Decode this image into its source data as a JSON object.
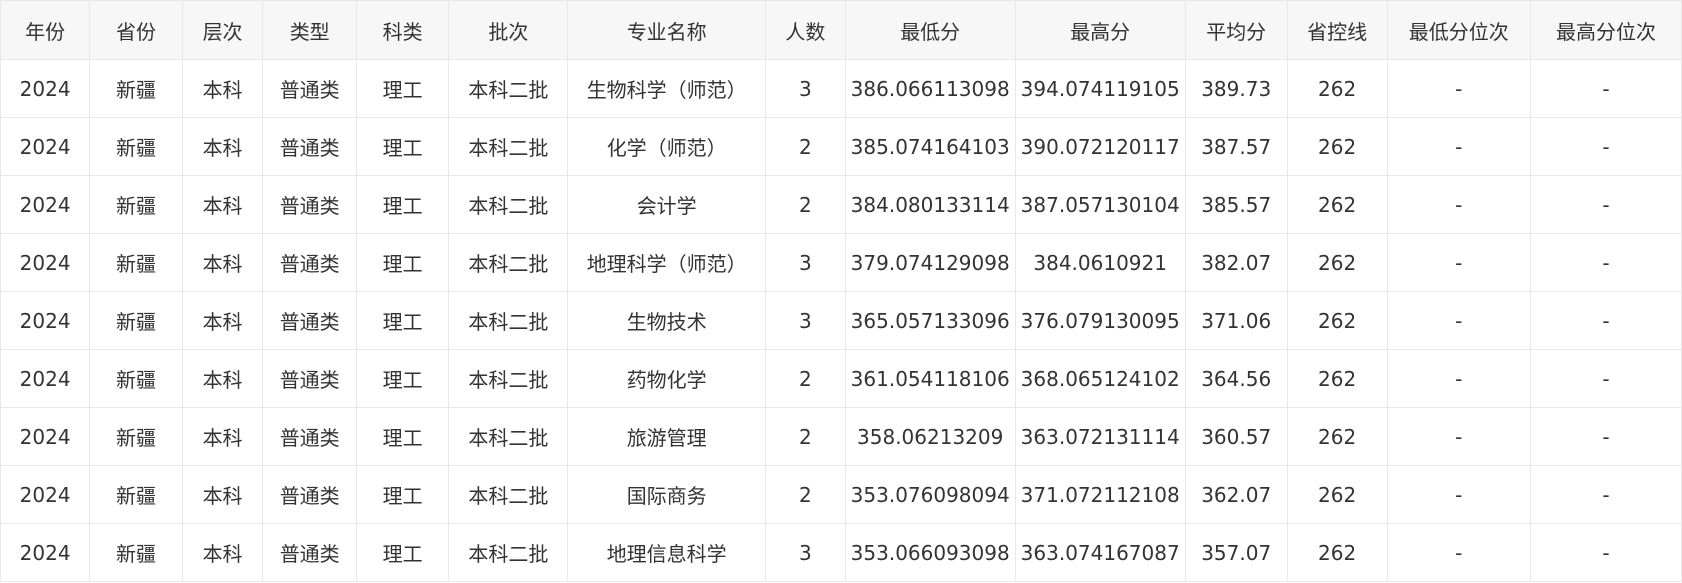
{
  "table": {
    "headers": [
      "年份",
      "省份",
      "层次",
      "类型",
      "科类",
      "批次",
      "专业名称",
      "人数",
      "最低分",
      "最高分",
      "平均分",
      "省控线",
      "最低分位次",
      "最高分位次"
    ],
    "rows": [
      [
        "2024",
        "新疆",
        "本科",
        "普通类",
        "理工",
        "本科二批",
        "生物科学（师范）",
        "3",
        "386.066113098",
        "394.074119105",
        "389.73",
        "262",
        "-",
        "-"
      ],
      [
        "2024",
        "新疆",
        "本科",
        "普通类",
        "理工",
        "本科二批",
        "化学（师范）",
        "2",
        "385.074164103",
        "390.072120117",
        "387.57",
        "262",
        "-",
        "-"
      ],
      [
        "2024",
        "新疆",
        "本科",
        "普通类",
        "理工",
        "本科二批",
        "会计学",
        "2",
        "384.080133114",
        "387.057130104",
        "385.57",
        "262",
        "-",
        "-"
      ],
      [
        "2024",
        "新疆",
        "本科",
        "普通类",
        "理工",
        "本科二批",
        "地理科学（师范）",
        "3",
        "379.074129098",
        "384.0610921",
        "382.07",
        "262",
        "-",
        "-"
      ],
      [
        "2024",
        "新疆",
        "本科",
        "普通类",
        "理工",
        "本科二批",
        "生物技术",
        "3",
        "365.057133096",
        "376.079130095",
        "371.06",
        "262",
        "-",
        "-"
      ],
      [
        "2024",
        "新疆",
        "本科",
        "普通类",
        "理工",
        "本科二批",
        "药物化学",
        "2",
        "361.054118106",
        "368.065124102",
        "364.56",
        "262",
        "-",
        "-"
      ],
      [
        "2024",
        "新疆",
        "本科",
        "普通类",
        "理工",
        "本科二批",
        "旅游管理",
        "2",
        "358.06213209",
        "363.072131114",
        "360.57",
        "262",
        "-",
        "-"
      ],
      [
        "2024",
        "新疆",
        "本科",
        "普通类",
        "理工",
        "本科二批",
        "国际商务",
        "2",
        "353.076098094",
        "371.072112108",
        "362.07",
        "262",
        "-",
        "-"
      ],
      [
        "2024",
        "新疆",
        "本科",
        "普通类",
        "理工",
        "本科二批",
        "地理信息科学",
        "3",
        "353.066093098",
        "363.074167087",
        "357.07",
        "262",
        "-",
        "-"
      ]
    ]
  }
}
